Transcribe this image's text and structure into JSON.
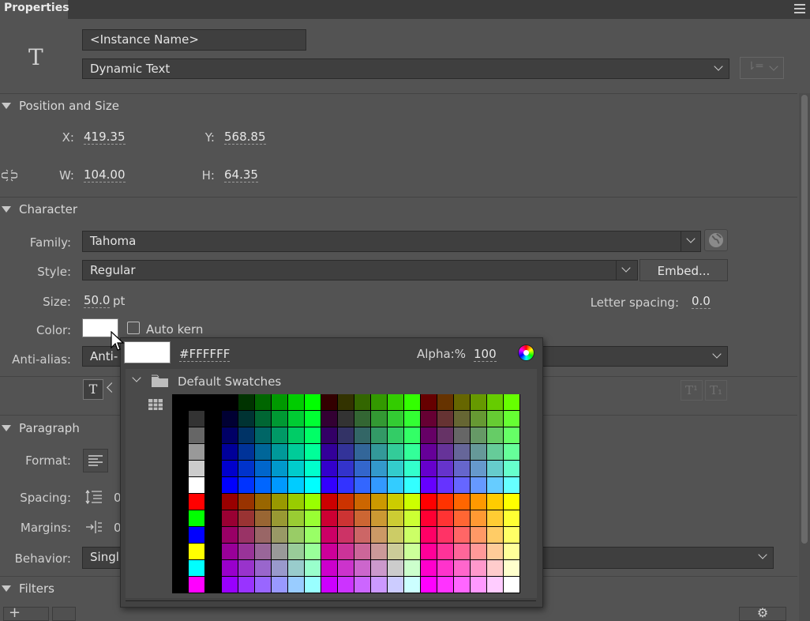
{
  "panel": {
    "tab_label": "Properties"
  },
  "instance": {
    "name_placeholder": "<Instance Name>",
    "text_type": "Dynamic Text"
  },
  "position_size": {
    "title": "Position and Size",
    "x_label": "X:",
    "x_value": "419.35",
    "y_label": "Y:",
    "y_value": "568.85",
    "w_label": "W:",
    "w_value": "104.00",
    "h_label": "H:",
    "h_value": "64.35"
  },
  "character": {
    "title": "Character",
    "family_label": "Family:",
    "family_value": "Tahoma",
    "style_label": "Style:",
    "style_value": "Regular",
    "embed_label": "Embed...",
    "size_label": "Size:",
    "size_value": "50.0",
    "size_unit": "pt",
    "letter_spacing_label": "Letter spacing:",
    "letter_spacing_value": "0.0",
    "color_label": "Color:",
    "color_value": "#ffffff",
    "auto_kern_label": "Auto kern",
    "anti_alias_label": "Anti-alias:",
    "anti_alias_value": "Anti-"
  },
  "paragraph": {
    "title": "Paragraph",
    "format_label": "Format:",
    "spacing_label": "Spacing:",
    "spacing_value": "0",
    "margins_label": "Margins:",
    "margins_value": "0",
    "behavior_label": "Behavior:",
    "behavior_value": "Singl"
  },
  "filters": {
    "title": "Filters"
  },
  "color_popup": {
    "hex_value": "#FFFFFF",
    "alpha_label": "Alpha:%",
    "alpha_value": "100",
    "swatch_folder_label": "Default Swatches"
  },
  "colors": {
    "panel_bg": "#535353",
    "tabbar_bg": "#3c3c3c",
    "field_bg": "#3f3f3f"
  },
  "icons": [
    "text-tool-icon",
    "link-icon",
    "globe-icon",
    "color-wheel-icon",
    "folder-icon",
    "swatch-grid-icon",
    "menu-icon"
  ]
}
